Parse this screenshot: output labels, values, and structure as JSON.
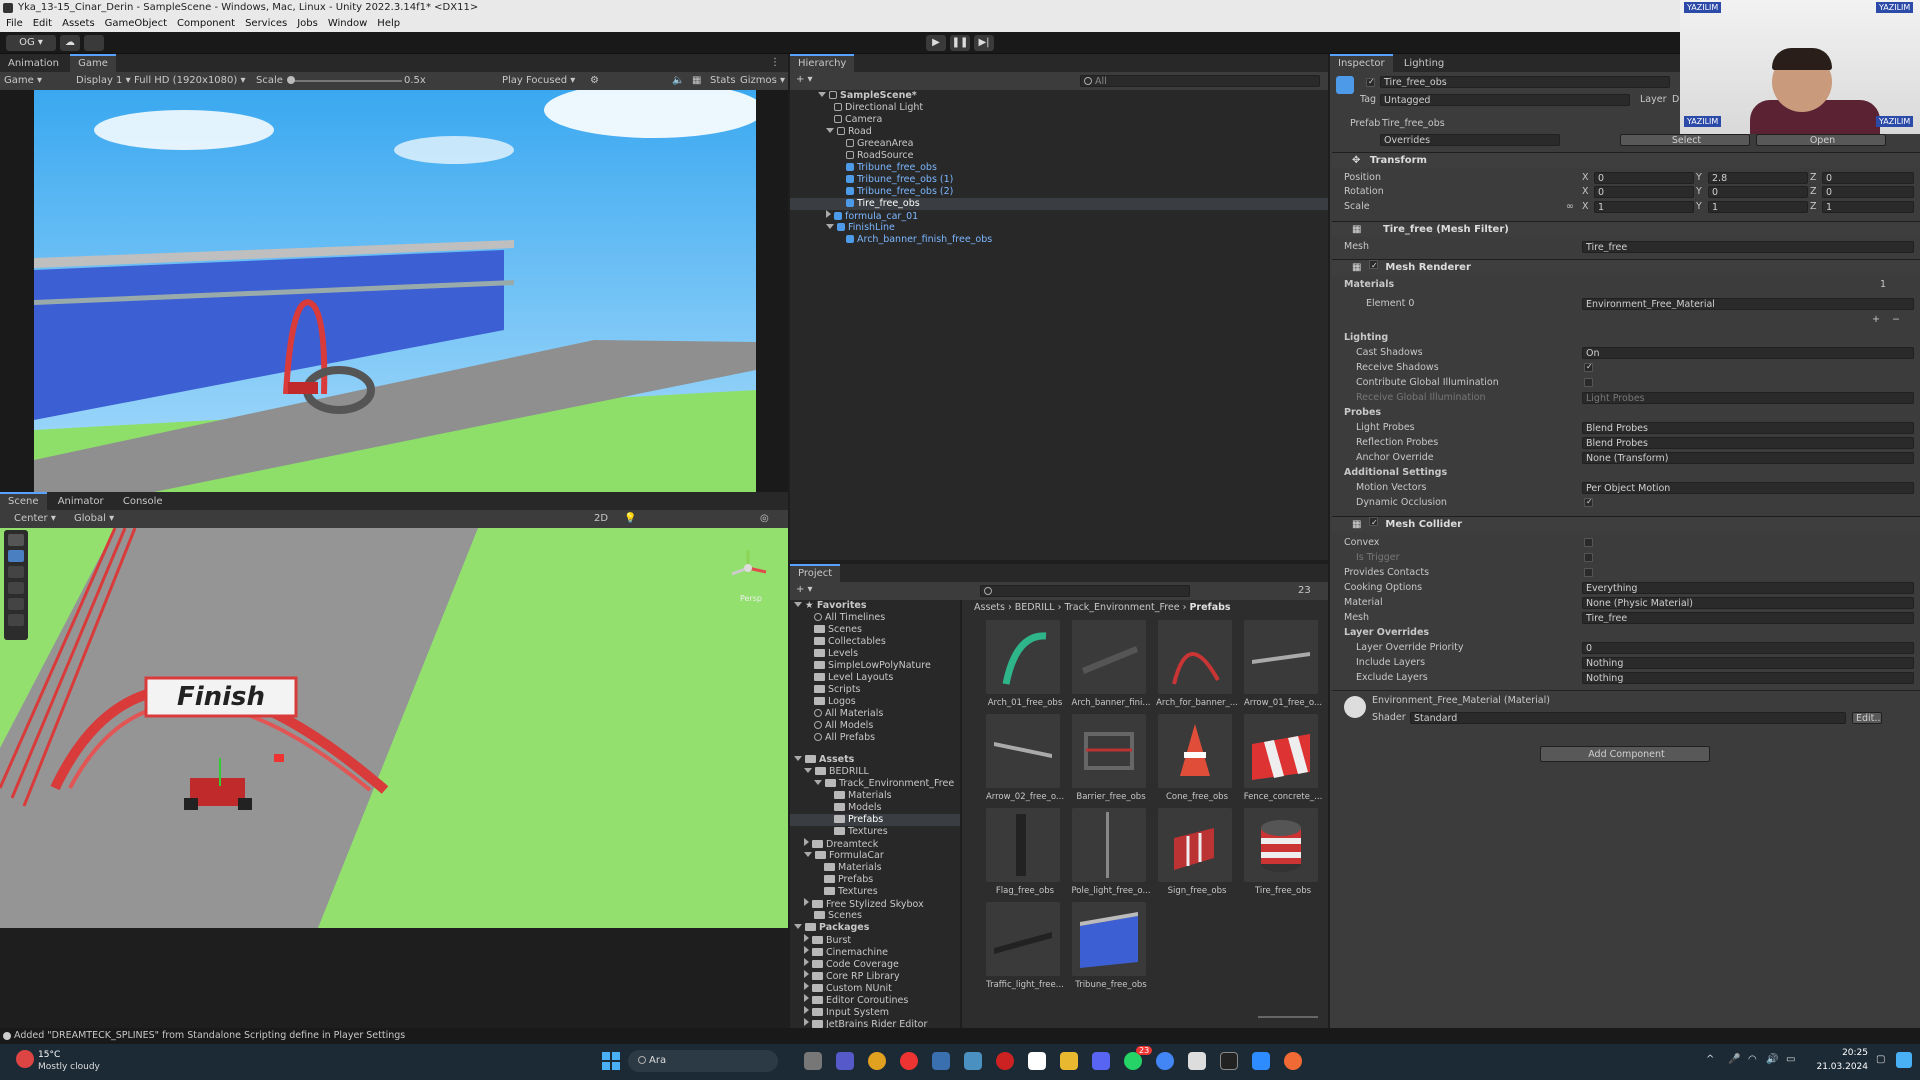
{
  "window": {
    "title": "Yka_13-15_Cinar_Derin - SampleScene - Windows, Mac, Linux - Unity 2022.3.14f1* <DX11>"
  },
  "menu": [
    "File",
    "Edit",
    "Assets",
    "GameObject",
    "Component",
    "Services",
    "Jobs",
    "Window",
    "Help"
  ],
  "toolbar": {
    "account": "OG"
  },
  "game_panel": {
    "tabs": [
      "Animation",
      "Game"
    ],
    "mode": "Game",
    "display": "Display 1",
    "resolution": "Full HD (1920x1080)",
    "scale_label": "Scale",
    "scale_value": "0.5x",
    "play_focused": "Play Focused",
    "stats": "Stats",
    "gizmos": "Gizmos"
  },
  "scene_panel": {
    "tabs": [
      "Scene",
      "Animator",
      "Console"
    ],
    "pivot": "Center",
    "space": "Global",
    "mode_2d": "2D",
    "banner_text": "Finish",
    "persp": "Persp"
  },
  "hierarchy": {
    "tab": "Hierarchy",
    "search_placeholder": "All",
    "items": [
      "SampleScene*",
      "Directional Light",
      "Camera",
      "Road",
      "GreeanArea",
      "RoadSource",
      "Tribune_free_obs",
      "Tribune_free_obs (1)",
      "Tribune_free_obs (2)",
      "Tire_free_obs",
      "formula_car_01",
      "FinishLine",
      "Arch_banner_finish_free_obs"
    ]
  },
  "project": {
    "tab": "Project",
    "count": "23",
    "breadcrumb": [
      "Assets",
      "BEDRILL",
      "Track_Environment_Free",
      "Prefabs"
    ],
    "favorites_label": "Favorites",
    "favorites": [
      "All Timelines",
      "Scenes",
      "Collectables",
      "Levels",
      "SimpleLowPolyNature",
      "Level Layouts",
      "Scripts",
      "Logos",
      "All Materials",
      "All Models",
      "All Prefabs"
    ],
    "assets_label": "Assets",
    "assets_tree": [
      "BEDRILL",
      "Track_Environment_Free",
      "Materials",
      "Models",
      "Prefabs",
      "Textures",
      "Dreamteck",
      "FormulaCar",
      "Materials",
      "Prefabs",
      "Textures",
      "Free Stylized Skybox",
      "Scenes"
    ],
    "packages_label": "Packages",
    "packages": [
      "Burst",
      "Cinemachine",
      "Code Coverage",
      "Core RP Library",
      "Custom NUnit",
      "Editor Coroutines",
      "Input System",
      "JetBrains Rider Editor"
    ],
    "grid": [
      "Arch_01_free_obs",
      "Arch_banner_fini...",
      "Arch_for_banner_...",
      "Arrow_01_free_o...",
      "Arrow_02_free_o...",
      "Barrier_free_obs",
      "Cone_free_obs",
      "Fence_concrete_...",
      "Flag_free_obs",
      "Pole_light_free_o...",
      "Sign_free_obs",
      "Tire_free_obs",
      "Traffic_light_free...",
      "Tribune_free_obs"
    ]
  },
  "inspector": {
    "tabs": [
      "Inspector",
      "Lighting"
    ],
    "object_name": "Tire_free_obs",
    "tag_label": "Tag",
    "tag_value": "Untagged",
    "layer_label": "Layer",
    "layer_value": "D",
    "prefab_label": "Prefab",
    "prefab_value": "Tire_free_obs",
    "overrides": "Overrides",
    "select": "Select",
    "open": "Open",
    "transform": {
      "title": "Transform",
      "position_label": "Position",
      "position": [
        "0",
        "2.8",
        "0"
      ],
      "rotation_label": "Rotation",
      "rotation": [
        "0",
        "0",
        "0"
      ],
      "scale_label": "Scale",
      "scale": [
        "1",
        "1",
        "1"
      ],
      "axes": [
        "X",
        "Y",
        "Z"
      ]
    },
    "mesh_filter": {
      "title": "Tire_free (Mesh Filter)",
      "mesh_label": "Mesh",
      "mesh_value": "Tire_free"
    },
    "mesh_renderer": {
      "title": "Mesh Renderer",
      "materials_label": "Materials",
      "materials_count": "1",
      "element0_label": "Element 0",
      "element0_value": "Environment_Free_Material",
      "lighting_label": "Lighting",
      "cast_shadows_label": "Cast Shadows",
      "cast_shadows": "On",
      "receive_shadows_label": "Receive Shadows",
      "contribute_gi_label": "Contribute Global Illumination",
      "receive_gi_label": "Receive Global Illumination",
      "receive_gi": "Light Probes",
      "probes_label": "Probes",
      "light_probes_label": "Light Probes",
      "light_probes": "Blend Probes",
      "reflection_probes_label": "Reflection Probes",
      "reflection_probes": "Blend Probes",
      "anchor_override_label": "Anchor Override",
      "anchor_override": "None (Transform)",
      "additional_label": "Additional Settings",
      "motion_vectors_label": "Motion Vectors",
      "motion_vectors": "Per Object Motion",
      "dynamic_occlusion_label": "Dynamic Occlusion"
    },
    "mesh_collider": {
      "title": "Mesh Collider",
      "convex_label": "Convex",
      "is_trigger_label": "Is Trigger",
      "provides_contacts_label": "Provides Contacts",
      "cooking_label": "Cooking Options",
      "cooking": "Everything",
      "material_label": "Material",
      "material": "None (Physic Material)",
      "mesh_label": "Mesh",
      "mesh": "Tire_free",
      "layer_overrides_label": "Layer Overrides",
      "priority_label": "Layer Override Priority",
      "priority": "0",
      "include_label": "Include Layers",
      "include": "Nothing",
      "exclude_label": "Exclude Layers",
      "exclude": "Nothing"
    },
    "material": {
      "title": "Environment_Free_Material (Material)",
      "shader_label": "Shader",
      "shader": "Standard",
      "edit": "Edit..."
    },
    "add_component": "Add Component"
  },
  "webcam": {
    "badge": "YAZILIM"
  },
  "status_bar": {
    "message": "Added \"DREAMTECK_SPLINES\" from Standalone Scripting define in Player Settings"
  },
  "taskbar": {
    "weather_temp": "15°C",
    "weather_desc": "Mostly cloudy",
    "search": "Ara",
    "time": "20:25",
    "date": "21.03.2024",
    "badge": "23"
  },
  "colors": {
    "accent": "#58a3ff",
    "prefab_blue": "#7cb7ff",
    "sky": "#5cb8f5",
    "grass": "#8ddf6a",
    "road": "#8f8f8f",
    "arch_red": "#d93a3a"
  }
}
